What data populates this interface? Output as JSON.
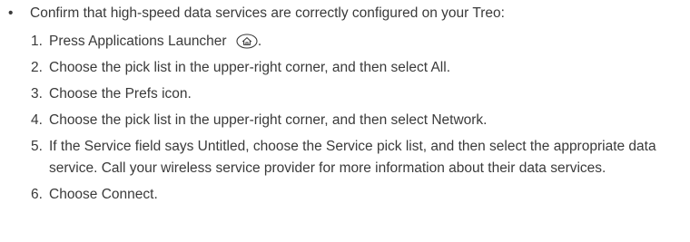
{
  "intro": {
    "bullet": "•",
    "text": "Confirm that high-speed data services are correctly configured on your Treo:"
  },
  "steps": [
    {
      "num": "1.",
      "text": "Press Applications Launcher",
      "suffix": ".",
      "icon": "home-launcher-icon"
    },
    {
      "num": "2.",
      "text": "Choose the pick list in the upper-right corner, and then select All."
    },
    {
      "num": "3.",
      "text": "Choose the Prefs icon."
    },
    {
      "num": "4.",
      "text": "Choose the pick list in the upper-right corner, and then select Network."
    },
    {
      "num": "5.",
      "text": "If the Service field says Untitled, choose the Service pick list, and then select the appropriate data service. Call your wireless service provider for more information about their data services."
    },
    {
      "num": "6.",
      "text": "Choose Connect."
    }
  ],
  "colors": {
    "text": "#3a3a3a"
  }
}
